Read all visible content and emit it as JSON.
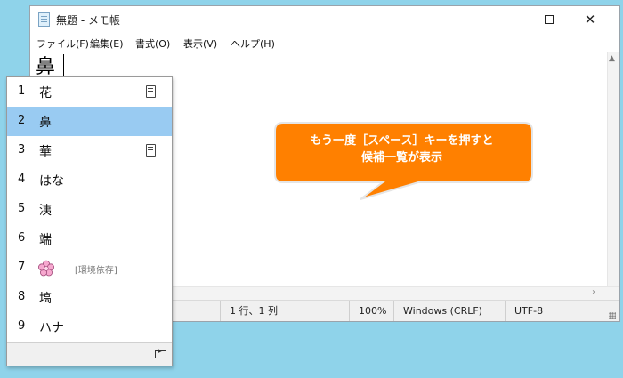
{
  "window": {
    "title": "無題 - メモ帳",
    "buttons": {
      "minimize": "minimize-icon",
      "maximize": "maximize-icon",
      "close": "✕"
    }
  },
  "menu": [
    "ファイル(F)",
    "編集(E)",
    "書式(O)",
    "表示(V)",
    "ヘルプ(H)"
  ],
  "editor": {
    "text": "鼻"
  },
  "status": {
    "position": "1 行、1 列",
    "zoom": "100%",
    "line_ending": "Windows (CRLF)",
    "encoding": "UTF-8"
  },
  "candidates": {
    "selected_index": 1,
    "items": [
      {
        "num": "1",
        "text": "花",
        "icon": "book-icon"
      },
      {
        "num": "2",
        "text": "鼻"
      },
      {
        "num": "3",
        "text": "華",
        "icon": "book-icon"
      },
      {
        "num": "4",
        "text": "はな"
      },
      {
        "num": "5",
        "text": "洟"
      },
      {
        "num": "6",
        "text": "端"
      },
      {
        "num": "7",
        "text": "",
        "icon": "flower-icon",
        "note": "[環境依存]"
      },
      {
        "num": "8",
        "text": "塙"
      },
      {
        "num": "9",
        "text": "ハナ"
      }
    ]
  },
  "callout": {
    "line1": "もう一度［スペース］キーを押すと",
    "line2": "候補一覧が表示",
    "fill": "#ff8000",
    "stroke": "#e5e5e5"
  },
  "colors": {
    "background": "#8fd3ea",
    "selected": "#99cbf2"
  }
}
